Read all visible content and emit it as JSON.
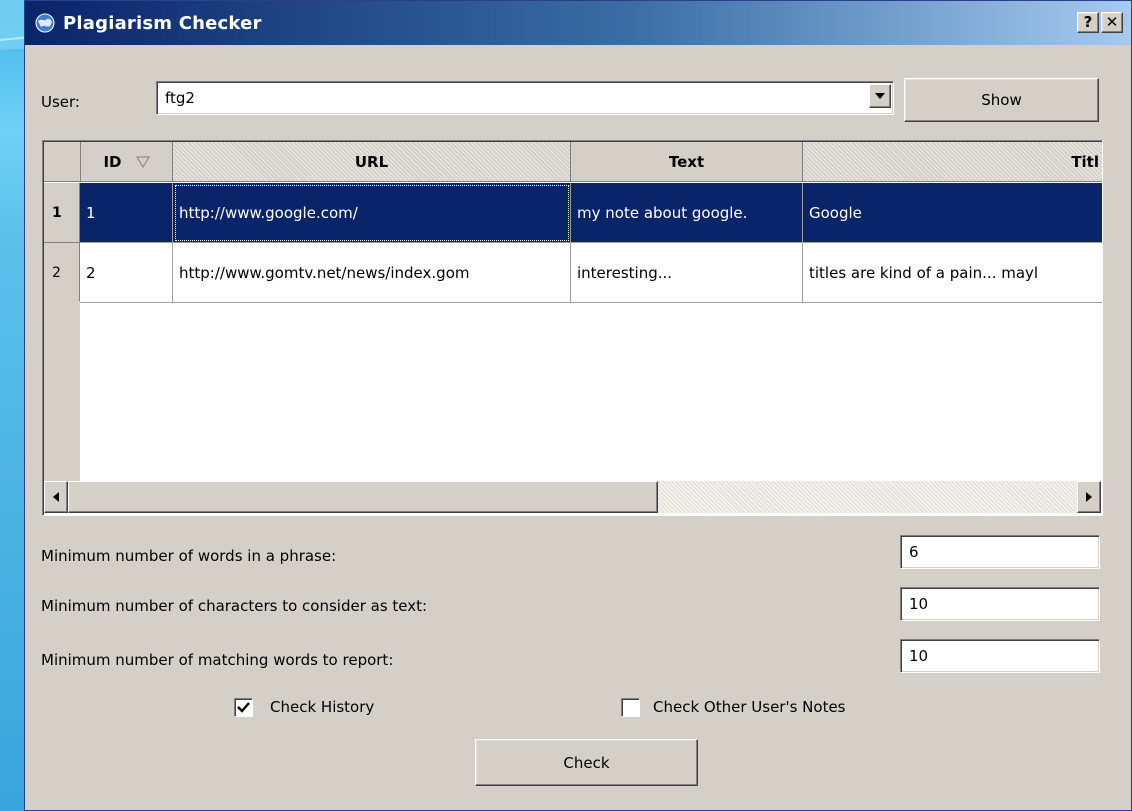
{
  "window": {
    "title": "Plagiarism Checker",
    "help_label": "?",
    "close_label": "✕"
  },
  "user": {
    "label": "User:",
    "value": "ftg2",
    "show_button": "Show"
  },
  "table": {
    "headers": {
      "id": "ID",
      "url": "URL",
      "text": "Text",
      "title": "Titl"
    },
    "rows": [
      {
        "num": "1",
        "id": "1",
        "url": "http://www.google.com/",
        "text": "my note about google.",
        "title": "Google"
      },
      {
        "num": "2",
        "id": "2",
        "url": "http://www.gomtv.net/news/index.gom",
        "text": "interesting...",
        "title": "titles are kind of a pain... mayl"
      }
    ]
  },
  "settings": {
    "min_words_label": "Minimum number of words in a phrase:",
    "min_words_value": "6",
    "min_chars_label": "Minimum number of characters to consider as text:",
    "min_chars_value": "10",
    "min_match_label": "Minimum number of matching words to report:",
    "min_match_value": "10"
  },
  "options": {
    "check_history_label": "Check History",
    "check_history_checked": true,
    "check_other_label": "Check Other User's Notes",
    "check_other_checked": false
  },
  "check_button": "Check",
  "colors": {
    "selection": "#0a246a",
    "dialog_bg": "#d4d0c8"
  }
}
